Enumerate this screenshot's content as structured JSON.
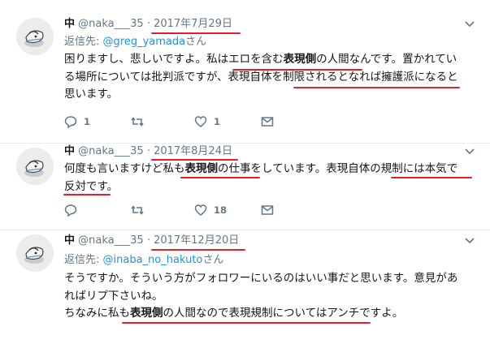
{
  "tweets": [
    {
      "name": "中",
      "handle": "@naka___35",
      "date": "2017年7月29日",
      "reply_prefix": "返信先: ",
      "reply_to": "@greg_yamada",
      "reply_suffix": "さん",
      "body": {
        "s1": "困りますし、悲しいですよ。私は",
        "s2": "エロを含む",
        "s3": "表現側",
        "s4": "の人間なんです。置かれてい",
        "s5": "る場所については批判派ですが、表現自体を",
        "s6": "制限されるとなれば擁護派になる",
        "s7": "と",
        "s8": "思います。"
      },
      "counts": {
        "replies": "1",
        "retweets": "",
        "likes": "1"
      }
    },
    {
      "name": "中",
      "handle": "@naka___35",
      "date": "2017年8月24日",
      "body": {
        "s1": "何度も言いますけど私も",
        "s2": "表現側",
        "s3": "の仕事",
        "s4": "をしています。表現自体の",
        "s5": "規制には本気で",
        "s6": "反対です",
        "s7": "。"
      },
      "counts": {
        "replies": "",
        "retweets": "",
        "likes": "18"
      }
    },
    {
      "name": "中",
      "handle": "@naka___35",
      "date": "2017年12月20日",
      "reply_prefix": "返信先: ",
      "reply_to": "@inaba_no_hakuto",
      "reply_suffix": "さん",
      "body": {
        "line1": "そうですか。そういう方がフォロワーにいるのはいい事だと思います。意見があ",
        "line2": "ればリプ下さいね。",
        "l3a": "ちなみに私も",
        "l3b": "表現側",
        "l3c": "の人間なので表現規制についてはアンチですよ。"
      }
    }
  ],
  "icons": [
    "avatar",
    "chevron-down-icon",
    "reply-icon",
    "retweet-icon",
    "like-icon",
    "message-icon"
  ],
  "colors": {
    "underline": "#e0202c",
    "link": "#1b95e0",
    "meta": "#657786"
  }
}
